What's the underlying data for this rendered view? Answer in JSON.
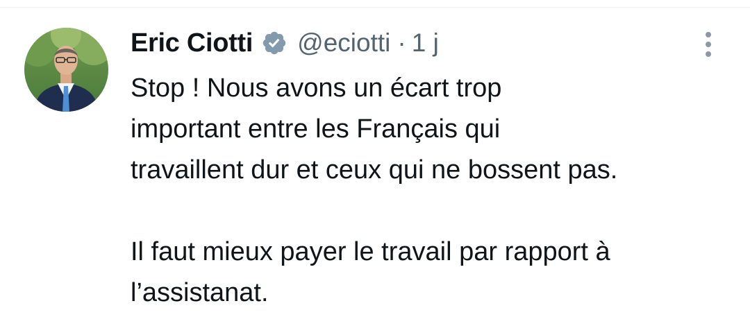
{
  "tweet": {
    "author": {
      "display_name": "Eric Ciotti",
      "handle": "@eciotti",
      "avatar": "avatar-photo",
      "verified_icon": "verified-badge-icon"
    },
    "separator": "·",
    "timestamp": "1 j",
    "more_icon": "more-options-icon",
    "text": {
      "para1": [
        "Stop ! Nous avons un écart trop",
        "important entre les Français qui",
        "travaillent dur et ceux qui ne bossent pas."
      ],
      "para2": [
        "Il faut mieux payer le travail par rapport à",
        "l’assistanat."
      ]
    }
  },
  "colors": {
    "text_primary": "#0f1419",
    "text_secondary": "#536471",
    "verified_badge": "#829aab",
    "divider": "#eff3f4"
  }
}
